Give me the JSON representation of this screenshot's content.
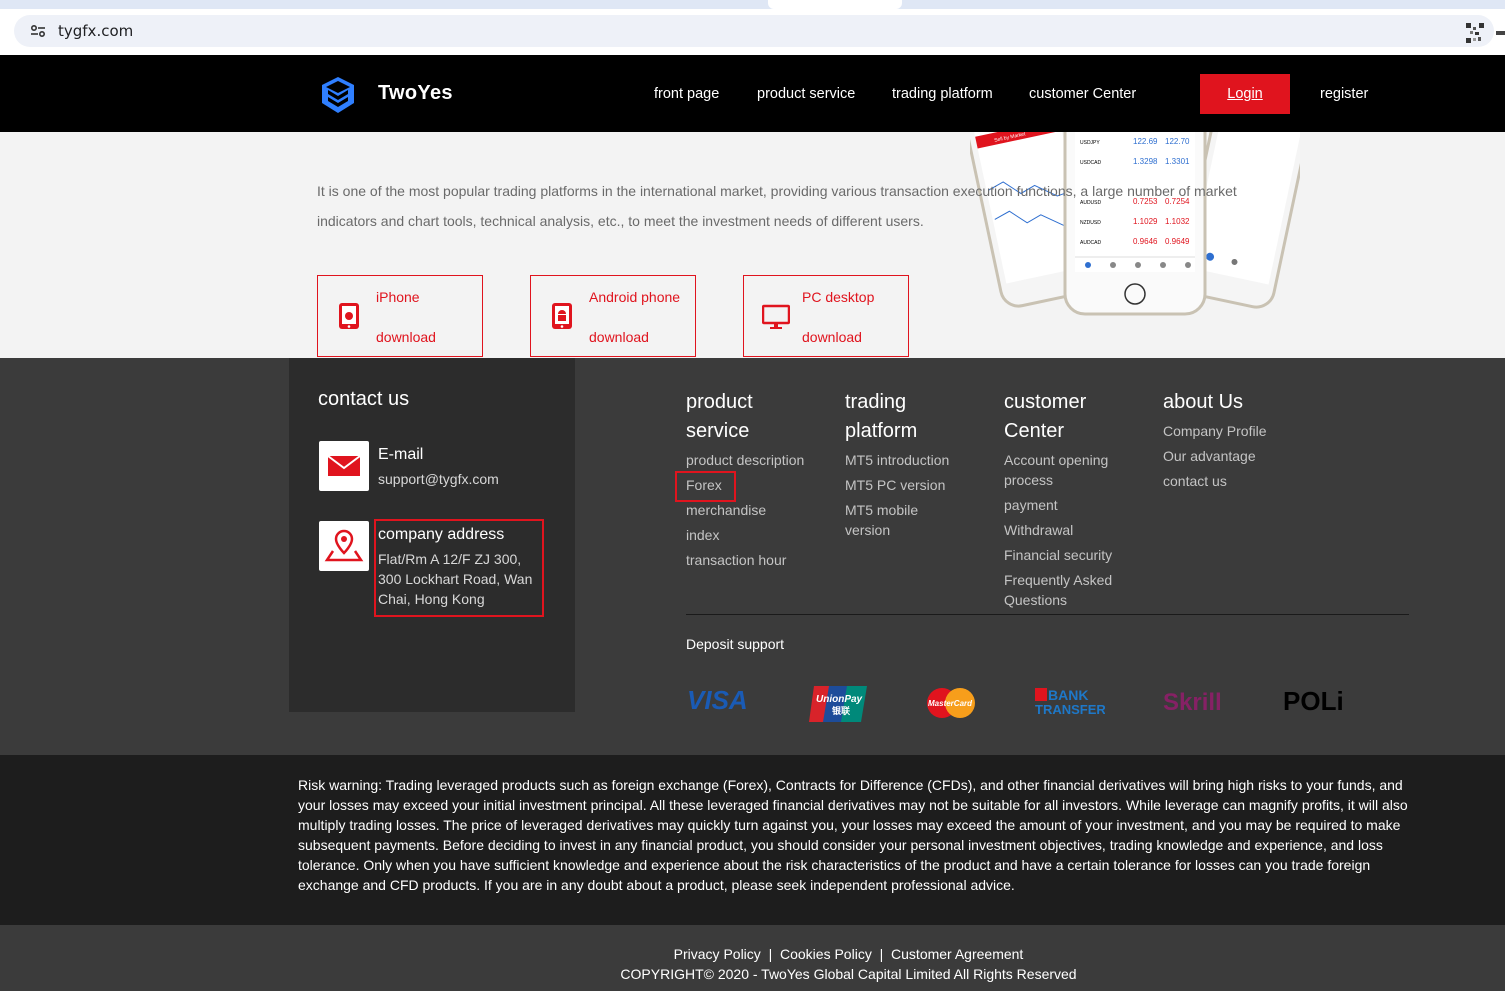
{
  "browser": {
    "url": "tygfx.com"
  },
  "nav": {
    "logo": "TwoYes",
    "links": [
      "front page",
      "product service",
      "trading platform",
      "customer Center"
    ],
    "login": "Login",
    "register": "register"
  },
  "hero": {
    "description": "It is one of the most popular trading platforms in the international market, providing various transaction execution functions, a large number of market indicators and chart tools, technical analysis, etc., to meet the investment needs of different users.",
    "downloads": [
      {
        "line1": "iPhone",
        "line2": "download",
        "icon": "apple-phone-icon"
      },
      {
        "line1": "Android phone",
        "line2": "download",
        "icon": "android-phone-icon"
      },
      {
        "line1": "PC desktop",
        "line2": "download",
        "icon": "monitor-icon"
      }
    ]
  },
  "contact": {
    "title": "contact us",
    "email_label": "E-mail",
    "email_value": "support@tygfx.com",
    "address_label": "company address",
    "address_lines": [
      "Flat/Rm A 12/F ZJ 300,",
      "300 Lockhart Road, Wan",
      "Chai, Hong Kong"
    ]
  },
  "footer_columns": [
    {
      "title": [
        "product",
        "service"
      ],
      "links": [
        "product description",
        "Forex",
        "merchandise",
        "index",
        "transaction hour"
      ]
    },
    {
      "title": [
        "trading",
        "platform"
      ],
      "links": [
        "MT5 introduction",
        "MT5 PC version",
        "MT5 mobile\nversion"
      ]
    },
    {
      "title": [
        "customer",
        "Center"
      ],
      "links": [
        "Account opening\nprocess",
        "payment",
        "Withdrawal",
        "Financial security",
        "Frequently Asked\nQuestions"
      ]
    },
    {
      "title": [
        "about Us"
      ],
      "links": [
        "Company Profile",
        "Our advantage",
        "contact us"
      ]
    }
  ],
  "deposit": {
    "title": "Deposit support",
    "methods": [
      "VISA",
      "UnionPay 银联",
      "MasterCard",
      "BANK TRANSFER",
      "Skrill",
      "POLi"
    ]
  },
  "risk_warning": "Risk warning: Trading leveraged products such as foreign exchange (Forex), Contracts for Difference (CFDs), and other financial derivatives will bring high risks to your funds, and your losses may exceed your initial investment principal. All these leveraged financial derivatives may not be suitable for all investors. While leverage can magnify profits, it will also multiply trading losses. The price of leveraged derivatives may quickly turn against you, your losses may exceed the amount of your investment, and you may be required to make subsequent payments. Before deciding to invest in any financial product, you should consider your personal investment objectives, trading knowledge and experience, and loss tolerance. Only when you have sufficient knowledge and experience about the risk characteristics of the product and have a certain tolerance for losses can you trade foreign exchange and CFD products. If you are in any doubt about a product, please seek independent professional advice.",
  "bottom": {
    "privacy": "Privacy Policy",
    "cookies": "Cookies Policy",
    "agreement": "Customer Agreement",
    "separator": "|",
    "copyright": "COPYRIGHT© 2020 - TwoYes Global Capital Limited All Rights Reserved"
  },
  "colors": {
    "accent": "#e0141e",
    "nav_bg": "#000000",
    "footer_bg": "#3b3b3b",
    "contact_bg": "#2c2c2c",
    "risk_bg": "#1d1d1d"
  },
  "phone_quotes": {
    "symbols": [
      "USDJPY",
      "USDCAD",
      "AUDUSD",
      "NZDUSD",
      "AUDCAD"
    ],
    "bids": [
      "122.69",
      "1.3298",
      "0.7253",
      "1.1029",
      "0.9646"
    ],
    "asks": [
      "122.70",
      "1.3301",
      "0.7254",
      "1.1032",
      "0.9649"
    ],
    "sell_label": "Sell by Market"
  }
}
